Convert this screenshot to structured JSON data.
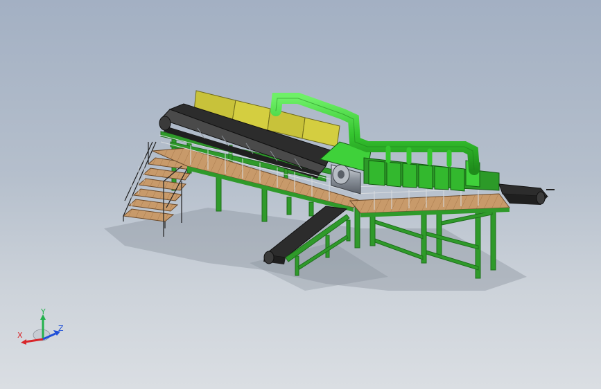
{
  "viewport": {
    "background_top": "#a3b0c3",
    "background_bottom": "#dadee3"
  },
  "model": {
    "colors": {
      "frame": "#2f9a2a",
      "frame_dark": "#1d6f1b",
      "duct": "#3fd13a",
      "hopper": "#c8c23a",
      "belt": "#2c2c2c",
      "deck": "#c89a6a",
      "drum": "#9aa1aa"
    },
    "parts": [
      "stair-access",
      "infeed-belt-conveyor",
      "hopper-side-panels",
      "dust-extraction-duct",
      "main-walkway-deck",
      "screening-drum",
      "separator-unit",
      "discharge-belt-conveyor",
      "outfeed-belt-conveyor",
      "support-frame"
    ]
  },
  "triad": {
    "x_label": "X",
    "y_label": "Y",
    "z_label": "Z",
    "x_color": "#d8262a",
    "y_color": "#22b14c",
    "z_color": "#1f4fd8"
  }
}
